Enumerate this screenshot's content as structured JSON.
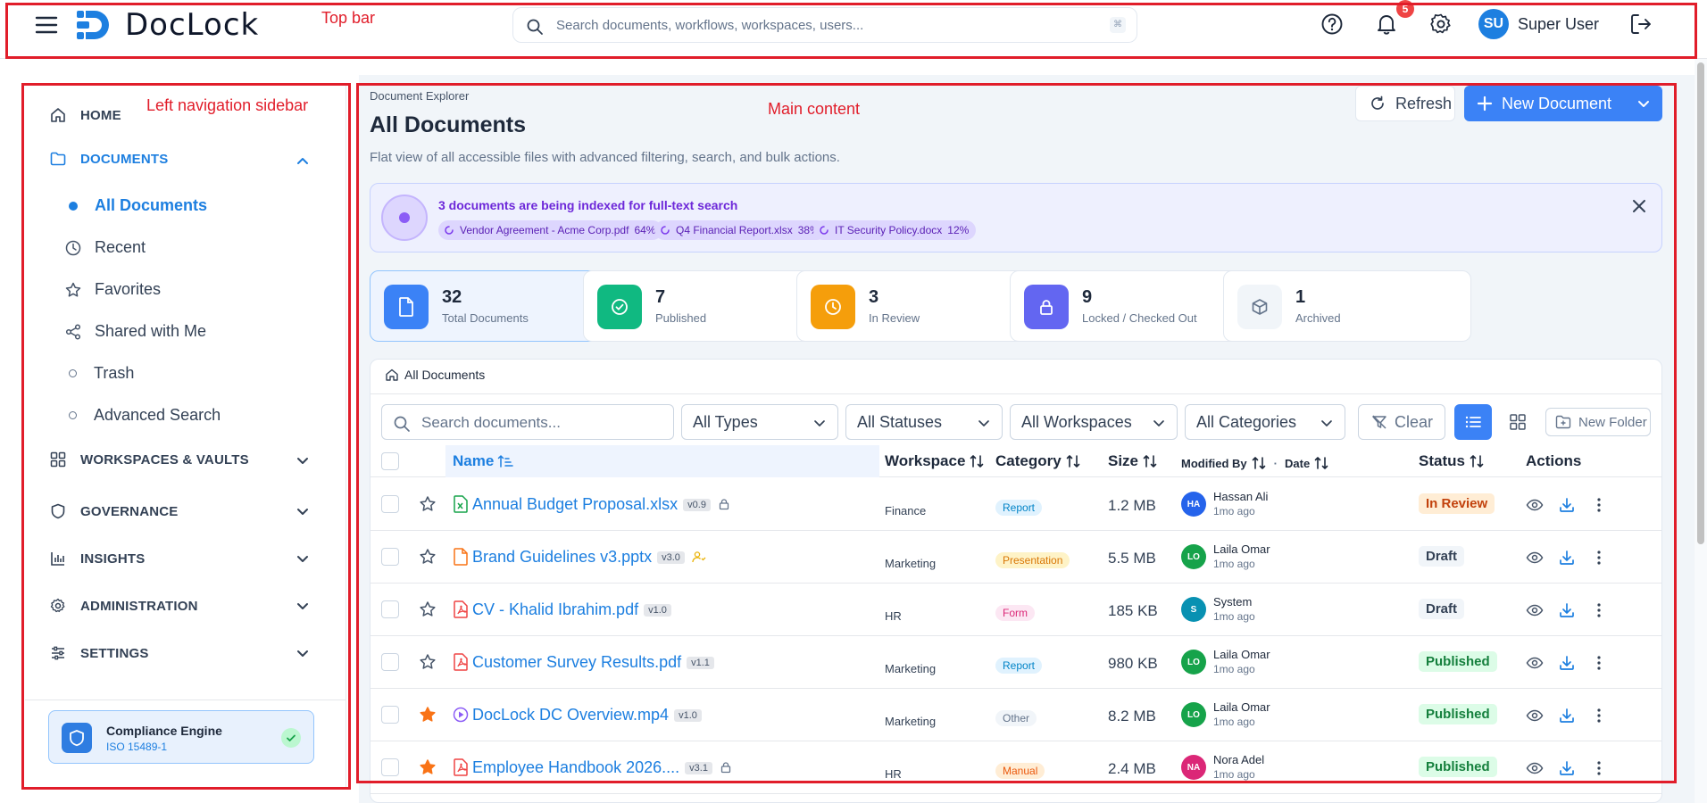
{
  "topbar": {
    "logo_text": "DocLock",
    "search_placeholder": "Search documents, workflows, workspaces, users...",
    "kbd_hint": "⌘",
    "notifications_count": "5",
    "user_initials": "SU",
    "user_name": "Super User"
  },
  "annotations": {
    "top_bar": "Top bar",
    "sidebar": "Left navigation sidebar",
    "main": "Main content"
  },
  "sidebar": {
    "home": "HOME",
    "documents": "DOCUMENTS",
    "doc_items": [
      "All Documents",
      "Recent",
      "Favorites",
      "Shared with Me",
      "Trash",
      "Advanced Search"
    ],
    "sections": [
      "WORKSPACES & VAULTS",
      "GOVERNANCE",
      "INSIGHTS",
      "ADMINISTRATION",
      "SETTINGS"
    ],
    "compliance_title": "Compliance Engine",
    "compliance_sub": "ISO 15489-1"
  },
  "main": {
    "breadcrumb": "Document Explorer",
    "title": "All Documents",
    "subtitle": "Flat view of all accessible files with advanced filtering, search, and bulk actions.",
    "refresh_label": "Refresh",
    "new_document_label": "New Document",
    "indexing": {
      "title": "3 documents are being indexed for full-text search",
      "chips": [
        {
          "name": "Vendor Agreement - Acme Corp.pdf",
          "pct": "64%"
        },
        {
          "name": "Q4 Financial Report.xlsx",
          "pct": "38%"
        },
        {
          "name": "IT Security Policy.docx",
          "pct": "12%"
        }
      ]
    },
    "stats": [
      {
        "value": "32",
        "label": "Total Documents",
        "color": "#3b82f6"
      },
      {
        "value": "7",
        "label": "Published",
        "color": "#10b981"
      },
      {
        "value": "3",
        "label": "In Review",
        "color": "#f59e0b"
      },
      {
        "value": "9",
        "label": "Locked / Checked Out",
        "color": "#6366f1"
      },
      {
        "value": "1",
        "label": "Archived",
        "color": "#f1f5f9"
      }
    ],
    "panel_crumb": "All Documents",
    "filters": {
      "search_placeholder": "Search documents...",
      "types": "All Types",
      "statuses": "All Statuses",
      "workspaces": "All Workspaces",
      "categories": "All Categories",
      "clear": "Clear",
      "new_folder": "New Folder"
    },
    "table": {
      "headers": {
        "name": "Name",
        "workspace": "Workspace",
        "category": "Category",
        "size": "Size",
        "modified_by": "Modified By",
        "date": "Date",
        "status": "Status",
        "actions": "Actions"
      },
      "rows": [
        {
          "name": "Annual Budget Proposal.xlsx",
          "ver": "v0.9",
          "locked": true,
          "ficon": "xlsx",
          "starred": false,
          "workspace": "Finance",
          "category": "Report",
          "size": "1.2 MB",
          "initials": "HA",
          "avatar_color": "#2563eb",
          "modified_by": "Hassan Ali",
          "time": "1mo ago",
          "status": "In Review"
        },
        {
          "name": "Brand Guidelines v3.pptx",
          "ver": "v3.0",
          "shared": true,
          "ficon": "pptx",
          "starred": false,
          "workspace": "Marketing",
          "category": "Presentation",
          "size": "5.5 MB",
          "initials": "LO",
          "avatar_color": "#16a34a",
          "modified_by": "Laila Omar",
          "time": "1mo ago",
          "status": "Draft"
        },
        {
          "name": "CV - Khalid Ibrahim.pdf",
          "ver": "v1.0",
          "ficon": "pdf",
          "starred": false,
          "workspace": "HR",
          "category": "Form",
          "size": "185 KB",
          "initials": "S",
          "avatar_color": "#0891b2",
          "modified_by": "System",
          "time": "1mo ago",
          "status": "Draft"
        },
        {
          "name": "Customer Survey Results.pdf",
          "ver": "v1.1",
          "ficon": "pdf",
          "starred": false,
          "workspace": "Marketing",
          "category": "Report",
          "size": "980 KB",
          "initials": "LO",
          "avatar_color": "#16a34a",
          "modified_by": "Laila Omar",
          "time": "1mo ago",
          "status": "Published"
        },
        {
          "name": "DocLock DC Overview.mp4",
          "ver": "v1.0",
          "ficon": "mp4",
          "starred": true,
          "workspace": "Marketing",
          "category": "Other",
          "size": "8.2 MB",
          "initials": "LO",
          "avatar_color": "#16a34a",
          "modified_by": "Laila Omar",
          "time": "1mo ago",
          "status": "Published"
        },
        {
          "name": "Employee Handbook 2026....",
          "ver": "v3.1",
          "locked": true,
          "ficon": "pdf",
          "starred": true,
          "workspace": "HR",
          "category": "Manual",
          "size": "2.4 MB",
          "initials": "NA",
          "avatar_color": "#db2777",
          "modified_by": "Nora Adel",
          "time": "1mo ago",
          "status": "Published"
        }
      ]
    }
  }
}
